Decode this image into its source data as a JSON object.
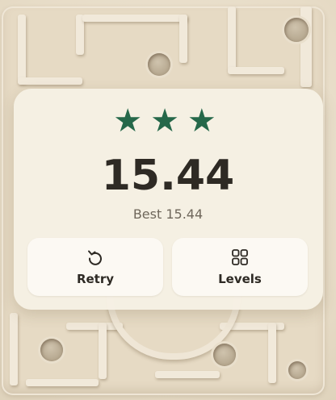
{
  "result": {
    "stars_earned": 3,
    "stars_total": 3,
    "star_color": "#25684a",
    "time": "15.44",
    "best_text": "Best 15.44"
  },
  "buttons": {
    "retry_label": "Retry",
    "retry_icon": "retry-icon",
    "levels_label": "Levels",
    "levels_icon": "levels-grid-icon"
  }
}
